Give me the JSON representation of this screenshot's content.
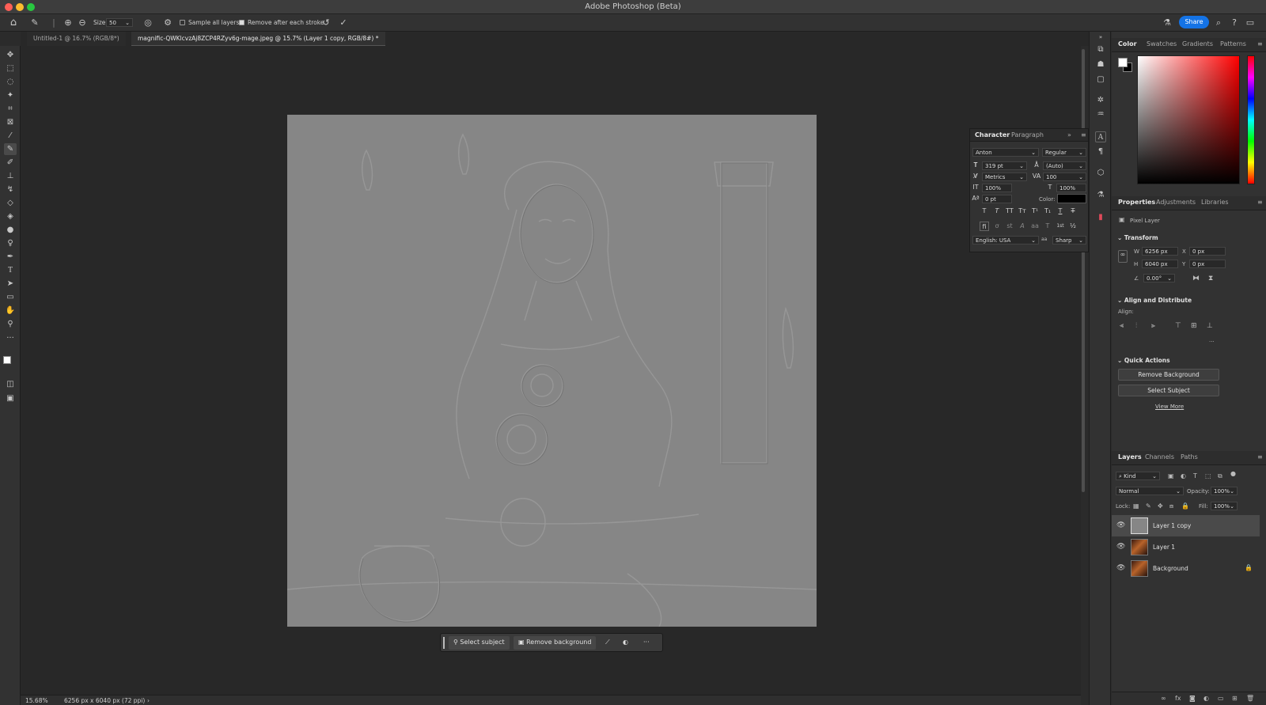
{
  "window": {
    "title": "Adobe Photoshop (Beta)"
  },
  "options_bar": {
    "size_label": "Size",
    "size_value": "50",
    "sample_all_layers": "Sample all layers",
    "remove_after_stroke": "Remove after each stroke",
    "share": "Share"
  },
  "tabs": [
    {
      "label": "Untitled-1 @ 16.7% (RGB/8*)"
    },
    {
      "label": "magnific-QWKlcvzAj8ZCP4RZyv6g-mage.jpeg @ 15.7% (Layer 1 copy, RGB/8#) *"
    }
  ],
  "context_bar": {
    "select_subject": "Select subject",
    "remove_background": "Remove background",
    "more": "···"
  },
  "status": {
    "zoom": "15.68%",
    "doc_info": "6256 px x 6040 px (72 ppi)",
    "arrow": "›"
  },
  "character_panel": {
    "tabs": [
      "Character",
      "Paragraph"
    ],
    "expand": "»",
    "font_family": "Anton",
    "font_style": "Regular",
    "font_size": "319 pt",
    "leading": "(Auto)",
    "kerning": "Metrics",
    "tracking": "100",
    "vertical_scale": "100%",
    "horizontal_scale": "100%",
    "baseline_shift": "0 pt",
    "color_label": "Color:",
    "language": "English: USA",
    "antialias_icon": "aa",
    "antialias": "Sharp",
    "type_buttons": [
      "T",
      "T",
      "TT",
      "Tт",
      "T¹",
      "T₁",
      "T",
      "T"
    ],
    "opentype_buttons": [
      "fi",
      "ơ",
      "st",
      "A",
      "aa",
      "T",
      "1st",
      "½"
    ]
  },
  "color_panel": {
    "tabs": [
      "Color",
      "Swatches",
      "Gradients",
      "Patterns"
    ]
  },
  "properties_panel": {
    "tabs": [
      "Properties",
      "Adjustments",
      "Libraries"
    ],
    "layer_type": "Pixel Layer",
    "transform_title": "Transform",
    "w_label": "W",
    "w_value": "6256 px",
    "x_label": "X",
    "x_value": "0 px",
    "h_label": "H",
    "h_value": "6040 px",
    "y_label": "Y",
    "y_value": "0 px",
    "angle": "0.00°",
    "align_title": "Align and Distribute",
    "align_label": "Align:",
    "more": "···",
    "quick_actions_title": "Quick Actions",
    "remove_background": "Remove Background",
    "select_subject": "Select Subject",
    "view_more": "View More"
  },
  "layers_panel": {
    "tabs": [
      "Layers",
      "Channels",
      "Paths"
    ],
    "kind": "Kind",
    "blend_mode": "Normal",
    "opacity_label": "Opacity:",
    "opacity": "100%",
    "lock_label": "Lock:",
    "fill_label": "Fill:",
    "fill": "100%",
    "layers": [
      {
        "name": "Layer 1 copy",
        "selected": true
      },
      {
        "name": "Layer 1",
        "selected": false
      },
      {
        "name": "Background",
        "selected": false,
        "locked": true
      }
    ]
  },
  "colors": {
    "accent": "#1473e6",
    "canvas_gray": "#868686",
    "foreground": "#ffffff",
    "background": "#000000"
  }
}
